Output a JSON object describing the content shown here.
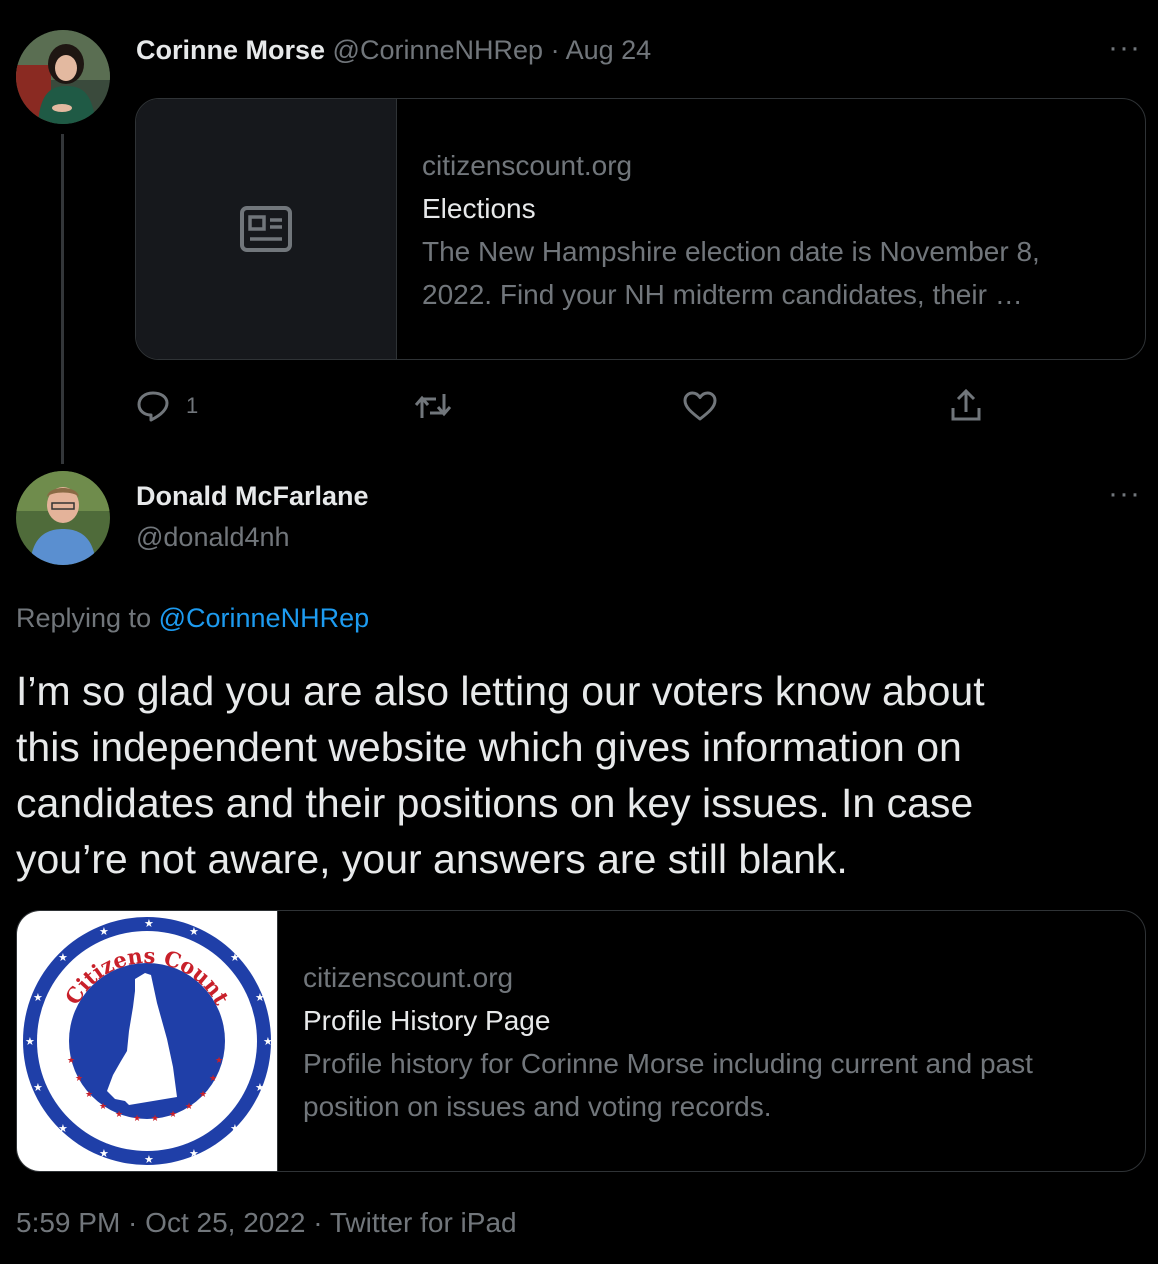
{
  "tweet1": {
    "display_name": "Corinne Morse",
    "handle": "@CorinneNHRep",
    "separator": "·",
    "date": "Aug 24",
    "more": "···",
    "card": {
      "domain": "citizenscount.org",
      "title": "Elections",
      "description_line1": "The New Hampshire election date is November 8,",
      "description_line2": "2022. Find your NH midterm candidates, their …",
      "icon": "newspaper-icon"
    },
    "actions": {
      "reply_count": "1",
      "reply_icon": "reply-icon",
      "retweet_icon": "retweet-icon",
      "like_icon": "heart-icon",
      "share_icon": "share-icon"
    }
  },
  "tweet2": {
    "display_name": "Donald McFarlane",
    "handle": "@donald4nh",
    "more": "···",
    "replying_prefix": "Replying to",
    "replying_handle": "@CorinneNHRep",
    "body_lines": [
      "I’m so glad you are also letting our voters know about",
      "this independent website which gives information on",
      "candidates and their positions on key issues. In case",
      "you’re not aware, your answers are still blank."
    ],
    "card": {
      "domain": "citizenscount.org",
      "title": "Profile History Page",
      "description_line1": "Profile history for Corinne Morse including current and past",
      "description_line2": "position on issues and voting records.",
      "logo_text": "Citizens Count"
    },
    "timestamp": "5:59 PM · Oct 25, 2022 · Twitter for iPad"
  },
  "colors": {
    "background": "#000000",
    "text": "#e7e9ea",
    "muted": "#71767b",
    "link": "#1d9bf0",
    "border": "#2f3336",
    "logo_blue": "#1f3fa8",
    "logo_red": "#c8202a"
  }
}
